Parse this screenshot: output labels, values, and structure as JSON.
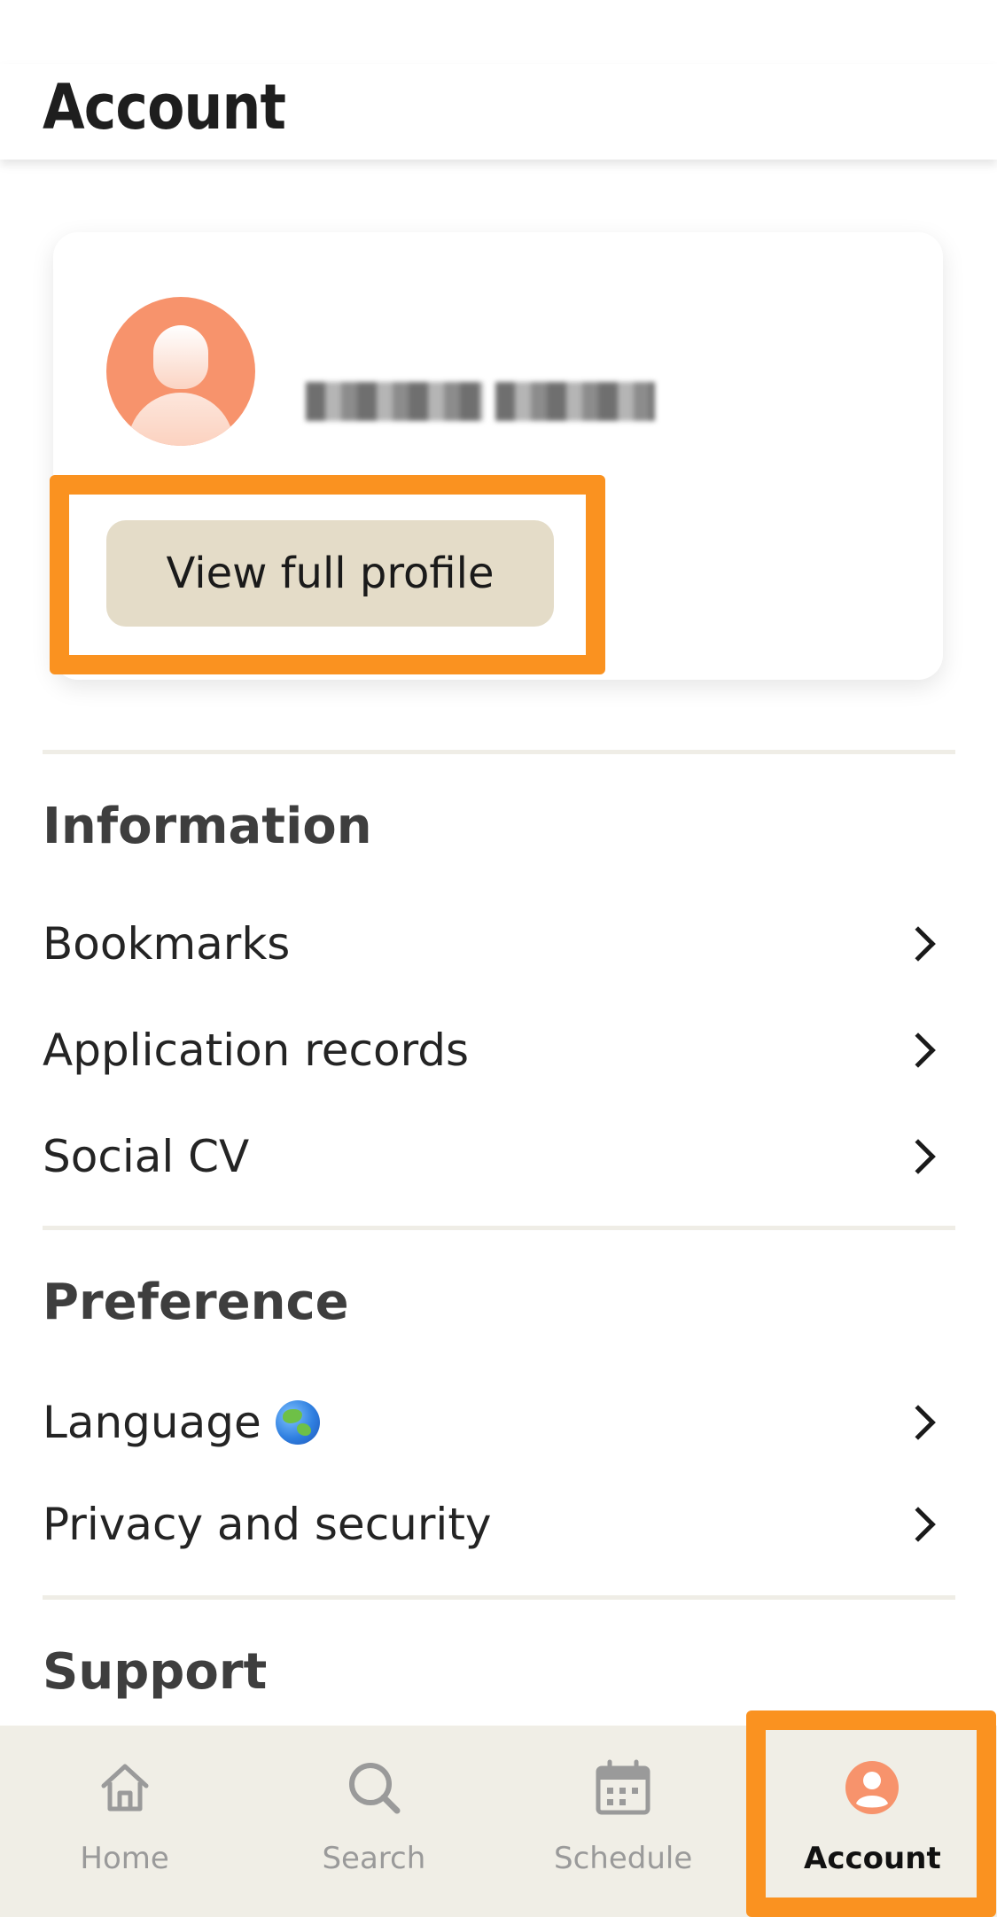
{
  "header": {
    "title": "Account"
  },
  "profile": {
    "name": "",
    "view_profile_label": "View full profile"
  },
  "sections": {
    "information": {
      "title": "Information",
      "items": [
        {
          "label": "Bookmarks"
        },
        {
          "label": "Application records"
        },
        {
          "label": "Social CV"
        }
      ]
    },
    "preference": {
      "title": "Preference",
      "items": [
        {
          "label": "Language",
          "icon": "globe-icon"
        },
        {
          "label": "Privacy and security"
        }
      ]
    },
    "support": {
      "title": "Support"
    }
  },
  "bottom_nav": {
    "items": [
      {
        "label": "Home",
        "icon": "home-icon",
        "active": false
      },
      {
        "label": "Search",
        "icon": "search-icon",
        "active": false
      },
      {
        "label": "Schedule",
        "icon": "calendar-icon",
        "active": false
      },
      {
        "label": "Account",
        "icon": "account-icon",
        "active": true
      }
    ]
  },
  "colors": {
    "accent": "#F7936C",
    "highlight": "#FA9220",
    "button_bg": "#E4DCC8",
    "nav_bg": "#F0EEE6"
  }
}
